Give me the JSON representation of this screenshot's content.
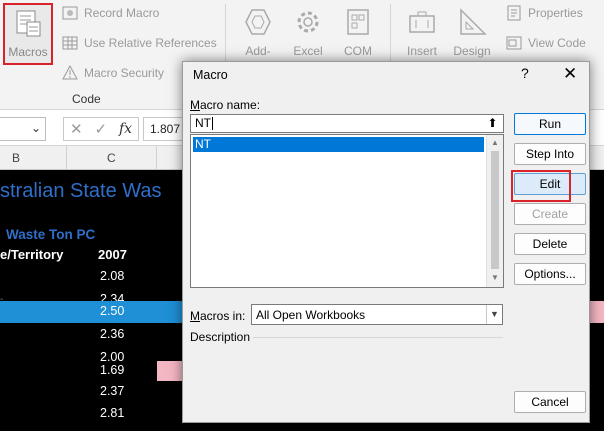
{
  "ribbon": {
    "code_group": {
      "macros_label": "Macros",
      "record_macro": "Record Macro",
      "use_relative": "Use Relative References",
      "macro_security": "Macro Security",
      "group_label": "Code"
    },
    "addins": [
      {
        "label": "Add-",
        "icon": "hexagon-icon"
      },
      {
        "label": "Excel",
        "icon": "gear-icon"
      },
      {
        "label": "COM",
        "icon": "com-addin-icon"
      }
    ],
    "controls": [
      {
        "label": "Insert",
        "icon": "toolbox-icon"
      },
      {
        "label": "Design",
        "icon": "ruler-triangle-icon"
      }
    ],
    "properties": "Properties",
    "view_code": "View Code"
  },
  "formula_bar": {
    "fx": "fx",
    "value": "1.807"
  },
  "columns": [
    "B",
    "C"
  ],
  "sheet": {
    "title": "stralian State Was",
    "subtitle": "Waste Ton PC",
    "header_state": "e/Territory",
    "header_year": "2007",
    "rows": [
      "2.08",
      "2.34",
      "2.50",
      "2.36",
      "2.00",
      "1.69",
      "2.37",
      "2.81"
    ]
  },
  "dialog": {
    "title": "Macro",
    "help": "?",
    "close": "✕",
    "macro_name_label": "Macro name:",
    "macro_name_value": "NT",
    "macros": [
      "NT"
    ],
    "macros_in_label": "Macros in:",
    "macros_in_value": "All Open Workbooks",
    "description_label": "Description",
    "buttons": {
      "run": "Run",
      "step_into": "Step Into",
      "edit": "Edit",
      "create": "Create",
      "delete": "Delete",
      "options": "Options...",
      "cancel": "Cancel"
    }
  },
  "colors": {
    "accent": "#0078d7",
    "title_blue": "#2f6fc9",
    "highlight_red": "#d8232a",
    "selected_row": "#1f8fd6",
    "pink": "#f4b6c2"
  }
}
